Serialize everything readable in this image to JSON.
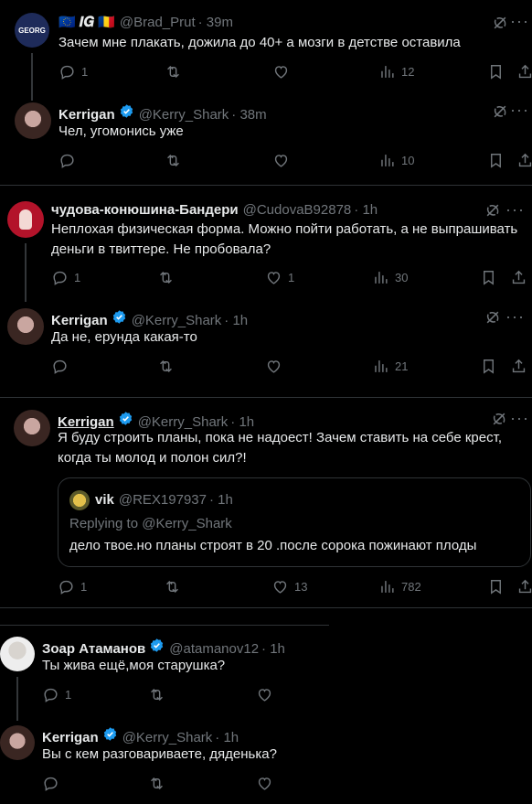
{
  "tweets": [
    {
      "name": "🇪🇺 𝑰𝑮 🇷🇴",
      "handle": "@Brad_Prut",
      "time": "· 39m",
      "avatar_label": "GEORG",
      "text": "Зачем мне плакать, дожила до 40+ а мозги в детстве оставила",
      "replies": "1",
      "retweets": "",
      "likes": "",
      "views": "12"
    },
    {
      "name": "Kerrigan",
      "handle": "@Kerry_Shark",
      "time": "· 38m",
      "text": "Чел, угомонись уже",
      "replies": "",
      "retweets": "",
      "likes": "",
      "views": "10"
    },
    {
      "name": "чудова-конюшина-Бандери",
      "handle": "@CudovaB92878",
      "time": "· 1h",
      "text": "Неплохая физическая форма. Можно пойти работать, а не выпрашивать деньги в твиттере. Не пробовала?",
      "replies": "1",
      "retweets": "",
      "likes": "1",
      "views": "30"
    },
    {
      "name": "Kerrigan",
      "handle": "@Kerry_Shark",
      "time": "· 1h",
      "text": "Да не, ерунда какая-то",
      "replies": "",
      "retweets": "",
      "likes": "",
      "views": "21"
    },
    {
      "name": "Kerrigan",
      "handle": "@Kerry_Shark",
      "time": "· 1h",
      "text": "Я буду строить планы, пока не надоест! Зачем ставить на себе крест, когда ты молод и полон сил?!",
      "replies": "1",
      "retweets": "",
      "likes": "13",
      "views": "782",
      "quote": {
        "name": "vik",
        "handle": "@REX197937",
        "time": "· 1h",
        "replying": "Replying to @Kerry_Shark",
        "text": "дело твое.но планы строят в 20 .после сорока пожинают плоды"
      }
    },
    {
      "name": "Зоар Атаманов",
      "handle": "@atamanov12",
      "time": "· 1h",
      "text": "Ты жива ещё,моя старушка?",
      "replies": "1",
      "retweets": "",
      "likes": ""
    },
    {
      "name": "Kerrigan",
      "handle": "@Kerry_Shark",
      "time": "· 1h",
      "text": "Вы с кем разговариваете, дяденька?",
      "replies": "",
      "retweets": "",
      "likes": ""
    }
  ],
  "colors": {
    "background": "#000000",
    "text": "#e7e9ea",
    "muted": "#71767b",
    "verified": "#1d9bf0",
    "divider": "#2f3336"
  }
}
